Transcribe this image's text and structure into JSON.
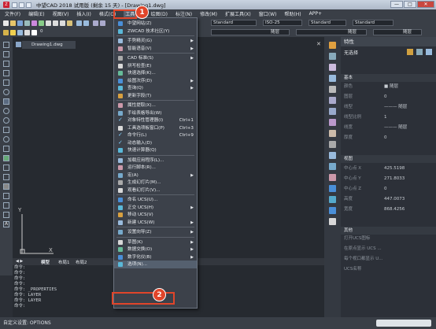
{
  "window": {
    "title": "中望CAD 2018 试用版 (剩余 15 天) - [Drawing1.dwg]",
    "min": "—",
    "max": "□",
    "close": "✕"
  },
  "menubar": [
    "文件(F)",
    "编辑(E)",
    "视图(V)",
    "插入(I)",
    "格式(O)",
    "工具(T)",
    "绘图(D)",
    "标注(N)",
    "修改(M)",
    "扩展工具(X)",
    "窗口(W)",
    "帮助(H)",
    "APP+"
  ],
  "toolbar": {
    "combo1": "Standard",
    "combo2": "ISO-25",
    "combo3": "Standard",
    "combo4": "Standard",
    "layer": "0",
    "line1": "随层",
    "line2": "随层",
    "line3": "随层"
  },
  "document_tab": "Drawing1.dwg",
  "layout_tabs": [
    "模型",
    "布局1",
    "布局2"
  ],
  "command_lines": [
    "命令:",
    "命令:",
    "命令:",
    "命令:",
    "命令: _PROPERTIES",
    "命令: LAYER",
    "命令: LAYER",
    "命令:"
  ],
  "command_prompt": "自定义设置: OPTIONS",
  "ucs": {
    "x": "X",
    "y": "Y"
  },
  "properties": {
    "title": "特性",
    "selection": "无选择",
    "sections": {
      "basic": "基本",
      "view": "视图",
      "misc": "其他"
    },
    "basic_rows": [
      {
        "k": "颜色",
        "v": "■ 随层"
      },
      {
        "k": "图层",
        "v": "0"
      },
      {
        "k": "线型",
        "v": "——— 随层"
      },
      {
        "k": "线型比例",
        "v": "1"
      },
      {
        "k": "线宽",
        "v": "——— 随层"
      },
      {
        "k": "厚度",
        "v": "0"
      }
    ],
    "view_rows": [
      {
        "k": "中心点 X",
        "v": "425.5198"
      },
      {
        "k": "中心点 Y",
        "v": "271.8033"
      },
      {
        "k": "中心点 Z",
        "v": "0"
      },
      {
        "k": "高度",
        "v": "447.0073"
      },
      {
        "k": "宽度",
        "v": "868.4256"
      }
    ],
    "misc_rows": [
      {
        "k": "打开UCS图标",
        "v": ""
      },
      {
        "k": "在原点显示 UCS ...",
        "v": ""
      },
      {
        "k": "每个视口都显示 U...",
        "v": ""
      },
      {
        "k": "UCS名称",
        "v": ""
      }
    ]
  },
  "menu": {
    "items": [
      {
        "label": "中望网站(Z)",
        "type": "item"
      },
      {
        "label": "ZWCAD 技术社区(Y)",
        "type": "item"
      },
      {
        "label": "",
        "type": "sep"
      },
      {
        "label": "手势精灵(G)",
        "type": "sub"
      },
      {
        "label": "智能语音(V)",
        "type": "sub"
      },
      {
        "label": "",
        "type": "sep"
      },
      {
        "label": "CAD 标准(S)",
        "type": "sub"
      },
      {
        "label": "拼写检查(E)",
        "type": "item"
      },
      {
        "label": "快速选择(K)...",
        "type": "item"
      },
      {
        "label": "绘图次序(D)",
        "type": "sub"
      },
      {
        "label": "查询(Q)",
        "type": "sub"
      },
      {
        "label": "更新字段(T)",
        "type": "item"
      },
      {
        "label": "",
        "type": "sep"
      },
      {
        "label": "属性提取(X)...",
        "type": "item"
      },
      {
        "label": "手绘表格导出(W)",
        "type": "item"
      },
      {
        "label": "对象特性管理器(I)",
        "type": "check",
        "shortcut": "Ctrl+1"
      },
      {
        "label": "工具选项板窗口(P)",
        "type": "item",
        "shortcut": "Ctrl+3"
      },
      {
        "label": "命令行(L)",
        "type": "check",
        "shortcut": "Ctrl+9"
      },
      {
        "label": "动态输入(D)",
        "type": "check"
      },
      {
        "label": "快速计算器(Q)",
        "type": "item"
      },
      {
        "label": "",
        "type": "sep"
      },
      {
        "label": "加载应用程序(L)...",
        "type": "item"
      },
      {
        "label": "运行脚本(R)...",
        "type": "item"
      },
      {
        "label": "宏(A)",
        "type": "sub"
      },
      {
        "label": "生成幻灯片(M)...",
        "type": "item"
      },
      {
        "label": "观看幻灯片(V)...",
        "type": "item"
      },
      {
        "label": "",
        "type": "sep"
      },
      {
        "label": "命名 UCS(U)...",
        "type": "item"
      },
      {
        "label": "正交 UCS(H)",
        "type": "sub"
      },
      {
        "label": "移动 UCS(V)",
        "type": "item"
      },
      {
        "label": "新建 UCS(W)",
        "type": "sub"
      },
      {
        "label": "",
        "type": "sep"
      },
      {
        "label": "设置向导(Z)",
        "type": "sub"
      },
      {
        "label": "",
        "type": "sep"
      },
      {
        "label": "草图(K)",
        "type": "sub"
      },
      {
        "label": "数据交换(O)",
        "type": "sub"
      },
      {
        "label": "数字化仪(B)",
        "type": "sub"
      },
      {
        "label": "选项(N)...",
        "type": "item",
        "highlight": true
      }
    ]
  },
  "callouts": [
    "1",
    "2"
  ],
  "colors": {
    "accent": "#e0452a",
    "check": "#7fd0ff"
  }
}
